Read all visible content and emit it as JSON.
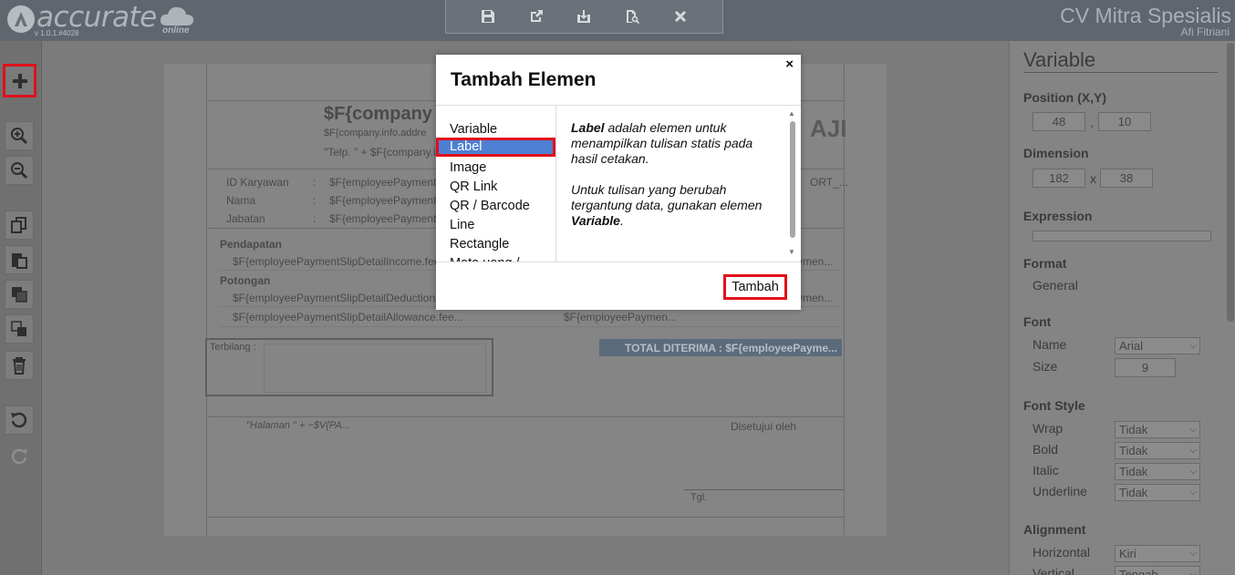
{
  "app": {
    "logo_text": "accurate",
    "logo_sub": "online",
    "version": "v 1.0.1.#4028",
    "company": "CV Mitra Spesialis",
    "user": "Afi Fitriani"
  },
  "toolbar": {
    "icons": [
      "save-icon",
      "export-icon",
      "download-icon",
      "preview-icon",
      "close-icon"
    ]
  },
  "leftbar": {
    "tools": [
      "add-icon",
      "zoom-in-icon",
      "zoom-out-icon",
      "copy-icon",
      "paste-icon",
      "bring-front-icon",
      "send-back-icon",
      "delete-icon",
      "undo-icon",
      "redo-icon"
    ]
  },
  "report": {
    "company_name": "$F{company",
    "company_address": "$F{company.info.addre",
    "company_phone": "\"Telp. \" + $F{company.i",
    "title_partial": "AJI",
    "fields": [
      {
        "label": "ID Karyawan",
        "sep": ":",
        "value": "$F{employeePayment"
      },
      {
        "label": "Nama",
        "sep": ":",
        "value": "$F{employeePayment"
      },
      {
        "label": "Jabatan",
        "sep": ":",
        "value": "$F{employeePayment"
      }
    ],
    "right_field": "ORT_...",
    "income_header": "Pendapatan",
    "income_row": "$F{employeePaymentSlipDetailIncome.fee",
    "income_value": "ymen...",
    "deduction_header": "Potongan",
    "deduction_row": "$F{employeePaymentSlipDetailDeduction.",
    "deduction_value": "ymen...",
    "allowance_row": "$F{employeePaymentSlipDetailAllowance.fee...",
    "allowance_value": "$F{employeePaymen...",
    "terbilang": "Terbilang :",
    "total": "TOTAL DITERIMA : $F{employeePayme...",
    "page_expr": "\"Halaman \" + ~$V{PA...",
    "approved": "Disetujui oleh",
    "date": "Tgl."
  },
  "modal": {
    "title": "Tambah Elemen",
    "close": "×",
    "items": [
      "Variable",
      "Label",
      "Image",
      "QR Link",
      "QR / Barcode",
      "Line",
      "Rectangle",
      "Mata uang / Simbol"
    ],
    "selected": "Label",
    "desc_bold1": "Label",
    "desc_text1": " adalah elemen untuk menampilkan tulisan statis pada hasil cetakan.",
    "desc_text2": "Untuk tulisan yang berubah tergantung data, gunakan elemen ",
    "desc_bold2": "Variable",
    "desc_end": ".",
    "add_button": "Tambah"
  },
  "properties": {
    "title": "Variable",
    "position_label": "Position (X,Y)",
    "pos_x": "48",
    "pos_sep": ",",
    "pos_y": "10",
    "dimension_label": "Dimension",
    "dim_w": "182",
    "dim_sep": "x",
    "dim_h": "38",
    "expression_label": "Expression",
    "format_label": "Format",
    "format_value": "General",
    "font_label": "Font",
    "font_name_label": "Name",
    "font_name_value": "Arial",
    "font_size_label": "Size",
    "font_size_value": "9",
    "font_style_label": "Font Style",
    "wrap_label": "Wrap",
    "wrap_value": "Tidak",
    "bold_label": "Bold",
    "bold_value": "Tidak",
    "italic_label": "Italic",
    "italic_value": "Tidak",
    "underline_label": "Underline",
    "underline_value": "Tidak",
    "alignment_label": "Alignment",
    "horizontal_label": "Horizontal",
    "horizontal_value": "Kiri",
    "vertical_label": "Vertical",
    "vertical_value": "Tengah"
  },
  "colors": {
    "highlight": "#e0101a",
    "selection": "#4e7fd3",
    "total_bg": "#5b6b7c"
  }
}
